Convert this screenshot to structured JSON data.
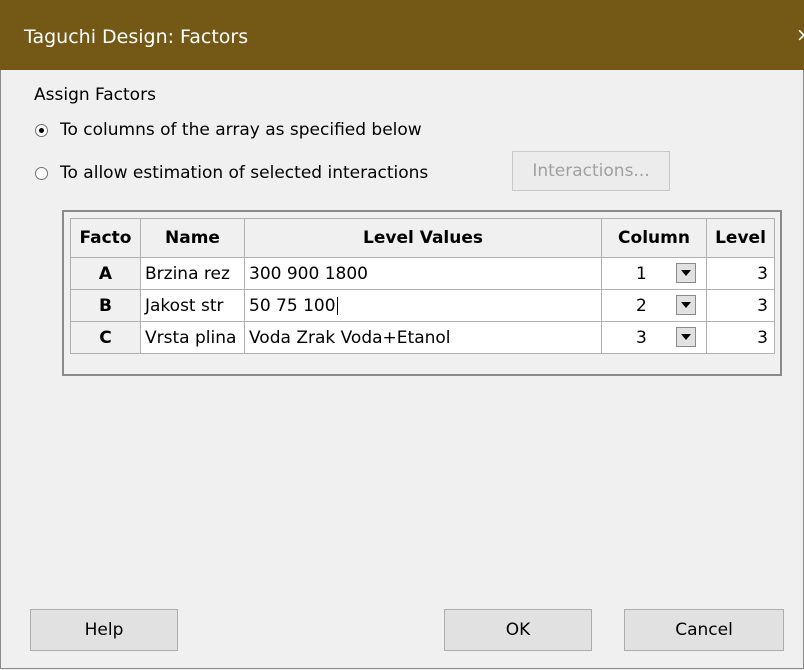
{
  "window": {
    "title": "Taguchi Design: Factors",
    "close_glyph": "×"
  },
  "assign": {
    "group_label": "Assign Factors",
    "option1_label": "To columns of the array as specified below",
    "option2_label": "To allow estimation of selected interactions",
    "selected_option": 1,
    "interactions_button": "Interactions..."
  },
  "table": {
    "headers": [
      "Facto",
      "Name",
      "Level Values",
      "Column",
      "Level"
    ],
    "rows": [
      {
        "factor": "A",
        "name": "Brzina rez",
        "level_values": "300 900 1800",
        "column": "1",
        "levels": "3"
      },
      {
        "factor": "B",
        "name": "Jakost str",
        "level_values": "50 75 100",
        "column": "2",
        "levels": "3"
      },
      {
        "factor": "C",
        "name": "Vrsta plina",
        "level_values": "Voda Zrak Voda+Etanol",
        "column": "3",
        "levels": "3"
      }
    ]
  },
  "buttons": {
    "help": "Help",
    "ok": "OK",
    "cancel": "Cancel"
  },
  "colors": {
    "titlebar": "#745816",
    "background": "#f0f0f0"
  }
}
